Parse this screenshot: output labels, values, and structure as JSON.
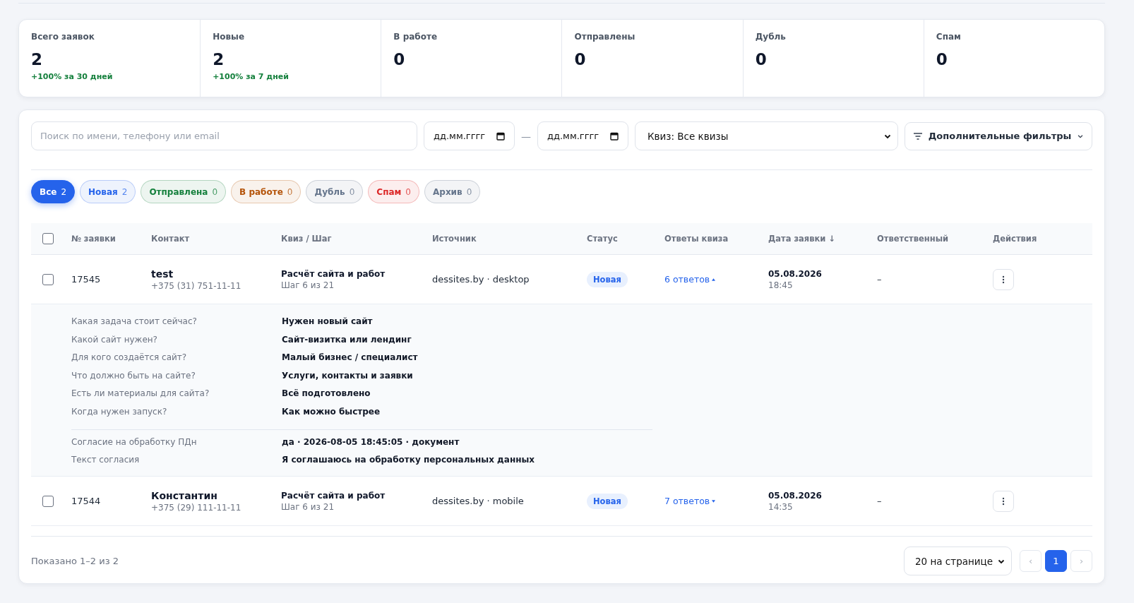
{
  "stats": [
    {
      "label": "Всего заявок",
      "value": "2",
      "trend": "+100% за 30 дней"
    },
    {
      "label": "Новые",
      "value": "2",
      "trend": "+100% за 7 дней"
    },
    {
      "label": "В работе",
      "value": "0"
    },
    {
      "label": "Отправлены",
      "value": "0"
    },
    {
      "label": "Дубль",
      "value": "0"
    },
    {
      "label": "Спам",
      "value": "0"
    }
  ],
  "filters": {
    "search": {
      "placeholder": "Поиск по имени, телефону или email"
    },
    "date_from": {
      "placeholder": "дд.мм.гггг"
    },
    "date_separator": "—",
    "date_to": {
      "placeholder": "дд.мм.гггг"
    },
    "quiz_select": "Квиз: Все квизы",
    "more_filters": "Дополнительные фильтры"
  },
  "status_tabs": [
    {
      "label": "Все",
      "count": "2",
      "color": "#2563eb",
      "selected": true
    },
    {
      "label": "Новая",
      "count": "2",
      "color": "#2563eb",
      "selected": false
    },
    {
      "label": "Отправлена",
      "count": "0",
      "color": "#15803d",
      "selected": false
    },
    {
      "label": "В работе",
      "count": "0",
      "color": "#b45309",
      "selected": false
    },
    {
      "label": "Дубль",
      "count": "0",
      "color": "#64748b",
      "selected": false
    },
    {
      "label": "Спам",
      "count": "0",
      "color": "#dc2626",
      "selected": false
    },
    {
      "label": "Архив",
      "count": "0",
      "color": "#64748b",
      "selected": false
    }
  ],
  "table": {
    "select_all_checked": false,
    "columns": [
      "№ заявки",
      "Контакт",
      "Квиз / Шаг",
      "Источник",
      "Статус",
      "Ответы квиза",
      "Дата заявки ↓",
      "Ответственный",
      "Действия"
    ],
    "rows": [
      {
        "checked": false,
        "number": "17545",
        "name": "test",
        "phone": "+375 (31) 751-11-11",
        "quiz": "Расчёт сайта и работ",
        "step": "Шаг 6 из 21",
        "source": "dessites.by · desktop",
        "status": "Новая",
        "answers": "6 ответов",
        "expanded": true,
        "date": "05.08.2026",
        "time": "18:45",
        "responsible": "–",
        "details": [
          {
            "question": "Какая задача стоит сейчас?",
            "answer": "Нужен новый сайт"
          },
          {
            "question": "Какой сайт нужен?",
            "answer": "Сайт-визитка или лендинг"
          },
          {
            "question": "Для кого создаётся сайт?",
            "answer": "Малый бизнес / специалист"
          },
          {
            "question": "Что должно быть на сайте?",
            "answer": "Услуги, контакты и заявки"
          },
          {
            "question": "Есть ли материалы для сайта?",
            "answer": "Всё подготовлено"
          },
          {
            "question": "Когда нужен запуск?",
            "answer": "Как можно быстрее"
          }
        ],
        "consent": [
          {
            "question": "Согласие на обработку ПДн",
            "answer": "да · 2026-08-05 18:45:05 · документ"
          },
          {
            "question": "Текст согласия",
            "answer": "Я соглашаюсь на обработку персональных данных"
          }
        ]
      },
      {
        "checked": false,
        "number": "17544",
        "name": "Константин",
        "phone": "+375 (29) 111-11-11",
        "quiz": "Расчёт сайта и работ",
        "step": "Шаг 6 из 21",
        "source": "dessites.by · mobile",
        "status": "Новая",
        "answers": "7 ответов",
        "expanded": false,
        "date": "05.08.2026",
        "time": "14:35",
        "responsible": "–"
      }
    ]
  },
  "footer": {
    "summary": "Показано 1–2 из 2",
    "page_size": "20 на странице",
    "prev": "‹",
    "pages": [
      {
        "label": "1",
        "selected": true
      }
    ],
    "next": "›"
  }
}
